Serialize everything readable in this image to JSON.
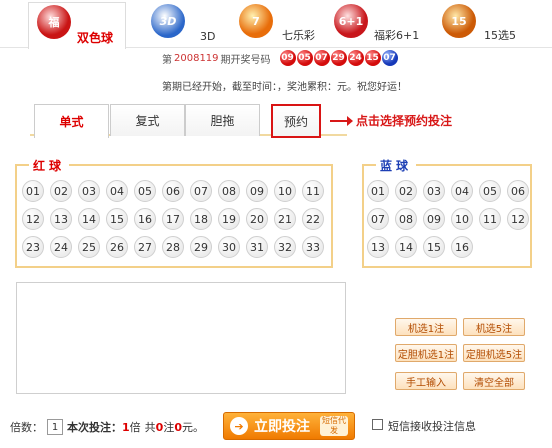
{
  "games": [
    {
      "label": "双色球",
      "logo": "ssq-logo",
      "active": true
    },
    {
      "label": "3D",
      "logo": "3d-logo",
      "active": false
    },
    {
      "label": "七乐彩",
      "logo": "qlc-logo",
      "active": false
    },
    {
      "label": "福彩6+1",
      "logo": "fc61-logo",
      "active": false
    },
    {
      "label": "15选5",
      "logo": "15x5-logo",
      "active": false
    }
  ],
  "draw": {
    "prefix": "第",
    "issue": "2008119",
    "suffix": "期开奖号码",
    "red_balls": [
      "09",
      "05",
      "07",
      "29",
      "24",
      "15"
    ],
    "blue_ball": "07"
  },
  "notice": "第期已经开始，截至时间：，奖池累积：元。祝您好运！",
  "mode_tabs": [
    "单式",
    "复式",
    "胆拖",
    "预约"
  ],
  "reserve_hint": "点击选择预约投注",
  "red_section": {
    "title": "红球",
    "numbers": [
      "01",
      "02",
      "03",
      "04",
      "05",
      "06",
      "07",
      "08",
      "09",
      "10",
      "11",
      "12",
      "13",
      "14",
      "15",
      "16",
      "17",
      "18",
      "19",
      "20",
      "21",
      "22",
      "23",
      "24",
      "25",
      "26",
      "27",
      "28",
      "29",
      "30",
      "31",
      "32",
      "33"
    ]
  },
  "blue_section": {
    "title": "蓝球",
    "numbers": [
      "01",
      "02",
      "03",
      "04",
      "05",
      "06",
      "07",
      "08",
      "09",
      "10",
      "11",
      "12",
      "13",
      "14",
      "15",
      "16"
    ]
  },
  "actions": {
    "random_1": "机选1注",
    "random_5": "机选5注",
    "dan_random_1": "定胆机选1注",
    "dan_random_5": "定胆机选5注",
    "manual": "手工输入",
    "clear_all": "清空全部"
  },
  "footer": {
    "multiple_label": "倍数：",
    "multiple_value": "1",
    "bet_label": "本次投注：",
    "bet_times": "1",
    "times_unit": "倍",
    "total_prefix": "共",
    "total_bets": "0",
    "bets_unit": "注",
    "amount": "0",
    "amount_unit": "元。",
    "submit_label": "立即投注",
    "sms_badge": "短信代发",
    "sms_label": "短信接收投注信息"
  }
}
